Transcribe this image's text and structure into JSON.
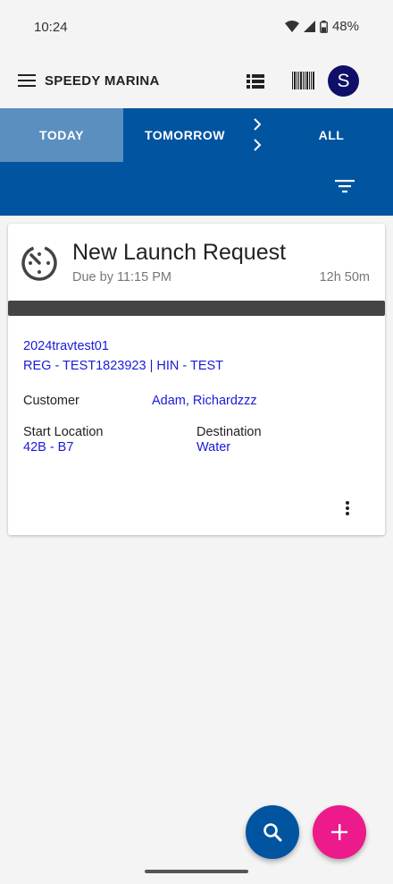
{
  "status_bar": {
    "time": "10:24",
    "battery": "48%"
  },
  "app_bar": {
    "title": "SPEEDY MARINA",
    "avatar_initial": "S",
    "avatar_color": "#0f0f6a"
  },
  "tabs": [
    {
      "label": "TODAY",
      "selected": true
    },
    {
      "label": "TOMORROW",
      "selected": false
    },
    {
      "label": "ALL",
      "selected": false
    }
  ],
  "colors": {
    "primary": "#0054a0",
    "selected_tab": "#5a8fc0",
    "accent": "#ec1a8a",
    "link": "#1a1adb"
  },
  "request_card": {
    "title": "New Launch Request",
    "due": "Due by 11:15 PM",
    "remaining": "12h 50m",
    "vessel_name": "2024travtest01",
    "vessel_reg": "REG - TEST1823923 | HIN - TEST",
    "customer_label": "Customer",
    "customer_value": "Adam, Richardzzz",
    "start_location_label": "Start Location",
    "start_location_value": "42B - B7",
    "destination_label": "Destination",
    "destination_value": "Water"
  },
  "icons": [
    "menu-icon",
    "list-icon",
    "barcode-icon",
    "chevron-right-icon",
    "filter-icon",
    "timer-icon",
    "more-vert-icon",
    "search-icon",
    "add-icon"
  ]
}
